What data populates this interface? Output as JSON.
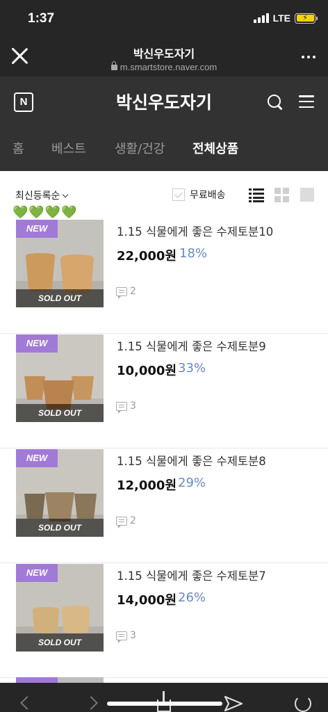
{
  "status": {
    "time": "1:37",
    "network": "LTE"
  },
  "browser": {
    "title": "박신우도자기",
    "url": "m.smartstore.naver.com"
  },
  "store": {
    "logo_letter": "N",
    "name": "박신우도자기",
    "tabs": [
      {
        "label": "홈",
        "active": false
      },
      {
        "label": "베스트",
        "active": false
      },
      {
        "label": "생활/건강",
        "active": false
      },
      {
        "label": "전체상품",
        "active": true
      }
    ]
  },
  "filter": {
    "sort_label": "최신등록순",
    "hearts": "💚💚💚💚",
    "free_shipping_label": "무료배송",
    "free_shipping_checked": false,
    "view_mode": "list"
  },
  "colors": {
    "new_badge": "#a17ad8",
    "discount": "#6a89c0",
    "header_bg": "#323232"
  },
  "products": [
    {
      "badge": "NEW",
      "status": "SOLD OUT",
      "name": "1.15 식물에게 좋은 수제토분10",
      "price": "22,000원",
      "discount": "18%",
      "reviews": "2"
    },
    {
      "badge": "NEW",
      "status": "SOLD OUT",
      "name": "1.15 식물에게 좋은 수제토분9",
      "price": "10,000원",
      "discount": "33%",
      "reviews": "3"
    },
    {
      "badge": "NEW",
      "status": "SOLD OUT",
      "name": "1.15 식물에게 좋은 수제토분8",
      "price": "12,000원",
      "discount": "29%",
      "reviews": "2"
    },
    {
      "badge": "NEW",
      "status": "SOLD OUT",
      "name": "1.15 식물에게 좋은 수제토분7",
      "price": "14,000원",
      "discount": "26%",
      "reviews": "3"
    }
  ]
}
